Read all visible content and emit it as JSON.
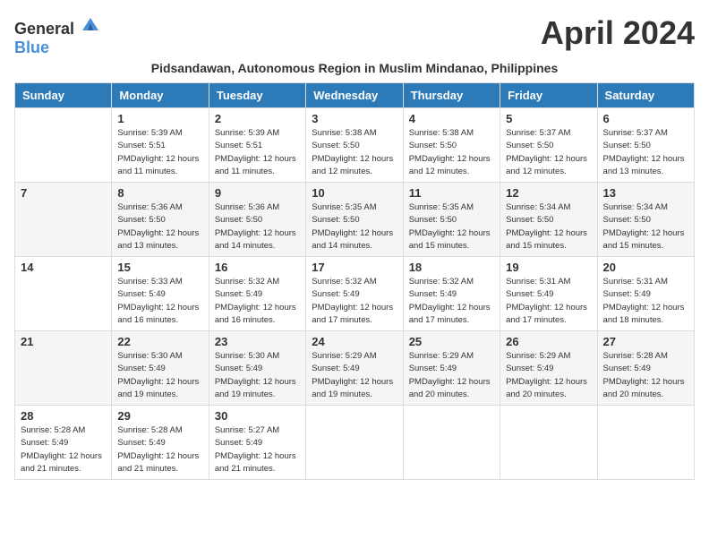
{
  "header": {
    "logo_general": "General",
    "logo_blue": "Blue",
    "month_title": "April 2024",
    "subtitle": "Pidsandawan, Autonomous Region in Muslim Mindanao, Philippines"
  },
  "days_of_week": [
    "Sunday",
    "Monday",
    "Tuesday",
    "Wednesday",
    "Thursday",
    "Friday",
    "Saturday"
  ],
  "weeks": [
    [
      {
        "day": "",
        "info": ""
      },
      {
        "day": "1",
        "info": "Sunrise: 5:39 AM\nSunset: 5:51 PM\nDaylight: 12 hours\nand 11 minutes."
      },
      {
        "day": "2",
        "info": "Sunrise: 5:39 AM\nSunset: 5:51 PM\nDaylight: 12 hours\nand 11 minutes."
      },
      {
        "day": "3",
        "info": "Sunrise: 5:38 AM\nSunset: 5:50 PM\nDaylight: 12 hours\nand 12 minutes."
      },
      {
        "day": "4",
        "info": "Sunrise: 5:38 AM\nSunset: 5:50 PM\nDaylight: 12 hours\nand 12 minutes."
      },
      {
        "day": "5",
        "info": "Sunrise: 5:37 AM\nSunset: 5:50 PM\nDaylight: 12 hours\nand 12 minutes."
      },
      {
        "day": "6",
        "info": "Sunrise: 5:37 AM\nSunset: 5:50 PM\nDaylight: 12 hours\nand 13 minutes."
      }
    ],
    [
      {
        "day": "7",
        "info": ""
      },
      {
        "day": "8",
        "info": "Sunrise: 5:36 AM\nSunset: 5:50 PM\nDaylight: 12 hours\nand 13 minutes."
      },
      {
        "day": "9",
        "info": "Sunrise: 5:36 AM\nSunset: 5:50 PM\nDaylight: 12 hours\nand 14 minutes."
      },
      {
        "day": "10",
        "info": "Sunrise: 5:35 AM\nSunset: 5:50 PM\nDaylight: 12 hours\nand 14 minutes."
      },
      {
        "day": "11",
        "info": "Sunrise: 5:35 AM\nSunset: 5:50 PM\nDaylight: 12 hours\nand 15 minutes."
      },
      {
        "day": "12",
        "info": "Sunrise: 5:34 AM\nSunset: 5:50 PM\nDaylight: 12 hours\nand 15 minutes."
      },
      {
        "day": "13",
        "info": "Sunrise: 5:34 AM\nSunset: 5:50 PM\nDaylight: 12 hours\nand 15 minutes."
      }
    ],
    [
      {
        "day": "14",
        "info": ""
      },
      {
        "day": "15",
        "info": "Sunrise: 5:33 AM\nSunset: 5:49 PM\nDaylight: 12 hours\nand 16 minutes."
      },
      {
        "day": "16",
        "info": "Sunrise: 5:32 AM\nSunset: 5:49 PM\nDaylight: 12 hours\nand 16 minutes."
      },
      {
        "day": "17",
        "info": "Sunrise: 5:32 AM\nSunset: 5:49 PM\nDaylight: 12 hours\nand 17 minutes."
      },
      {
        "day": "18",
        "info": "Sunrise: 5:32 AM\nSunset: 5:49 PM\nDaylight: 12 hours\nand 17 minutes."
      },
      {
        "day": "19",
        "info": "Sunrise: 5:31 AM\nSunset: 5:49 PM\nDaylight: 12 hours\nand 17 minutes."
      },
      {
        "day": "20",
        "info": "Sunrise: 5:31 AM\nSunset: 5:49 PM\nDaylight: 12 hours\nand 18 minutes."
      }
    ],
    [
      {
        "day": "21",
        "info": ""
      },
      {
        "day": "22",
        "info": "Sunrise: 5:30 AM\nSunset: 5:49 PM\nDaylight: 12 hours\nand 19 minutes."
      },
      {
        "day": "23",
        "info": "Sunrise: 5:30 AM\nSunset: 5:49 PM\nDaylight: 12 hours\nand 19 minutes."
      },
      {
        "day": "24",
        "info": "Sunrise: 5:29 AM\nSunset: 5:49 PM\nDaylight: 12 hours\nand 19 minutes."
      },
      {
        "day": "25",
        "info": "Sunrise: 5:29 AM\nSunset: 5:49 PM\nDaylight: 12 hours\nand 20 minutes."
      },
      {
        "day": "26",
        "info": "Sunrise: 5:29 AM\nSunset: 5:49 PM\nDaylight: 12 hours\nand 20 minutes."
      },
      {
        "day": "27",
        "info": "Sunrise: 5:28 AM\nSunset: 5:49 PM\nDaylight: 12 hours\nand 20 minutes."
      }
    ],
    [
      {
        "day": "28",
        "info": "Sunrise: 5:28 AM\nSunset: 5:49 PM\nDaylight: 12 hours\nand 21 minutes."
      },
      {
        "day": "29",
        "info": "Sunrise: 5:28 AM\nSunset: 5:49 PM\nDaylight: 12 hours\nand 21 minutes."
      },
      {
        "day": "30",
        "info": "Sunrise: 5:27 AM\nSunset: 5:49 PM\nDaylight: 12 hours\nand 21 minutes."
      },
      {
        "day": "",
        "info": ""
      },
      {
        "day": "",
        "info": ""
      },
      {
        "day": "",
        "info": ""
      },
      {
        "day": "",
        "info": ""
      }
    ]
  ]
}
